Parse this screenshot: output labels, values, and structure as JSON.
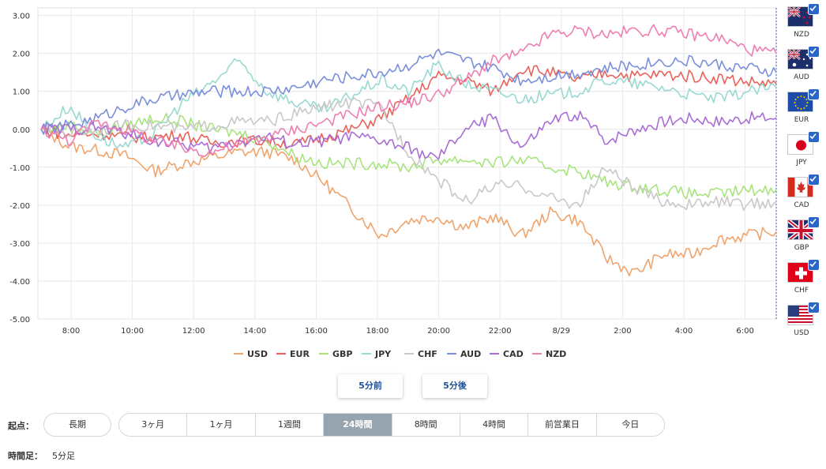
{
  "chart_data": {
    "type": "line",
    "ylim": [
      -5,
      3.2
    ],
    "y_ticks": [
      "3.00",
      "2.00",
      "1.00",
      "0.00",
      "-1.00",
      "-2.00",
      "-3.00",
      "-4.00",
      "-5.00"
    ],
    "x_ticks": [
      "8:00",
      "10:00",
      "12:00",
      "14:00",
      "16:00",
      "18:00",
      "20:00",
      "22:00",
      "8/29",
      "2:00",
      "4:00",
      "6:00"
    ],
    "grid": true,
    "legend_position": "bottom",
    "series": [
      {
        "name": "USD",
        "color": "#f0a46c",
        "values": [
          0,
          -0.45,
          -0.55,
          -0.7,
          -1.1,
          -0.9,
          -0.75,
          -0.6,
          -0.6,
          -0.8,
          -1.4,
          -2.1,
          -2.8,
          -2.4,
          -2.3,
          -2.6,
          -2.3,
          -2.8,
          -2.2,
          -2.4,
          -3.4,
          -3.8,
          -3.3,
          -3.3,
          -2.9,
          -2.8,
          -2.7
        ]
      },
      {
        "name": "EUR",
        "color": "#e8625b",
        "values": [
          0,
          -0.15,
          -0.1,
          -0.2,
          -0.2,
          -0.15,
          -0.35,
          -0.3,
          -0.3,
          -0.4,
          -0.2,
          0,
          0.3,
          0.8,
          1.4,
          1.3,
          1.0,
          1.6,
          1.5,
          1.3,
          1.5,
          1.4,
          1.45,
          1.4,
          1.35,
          1.25,
          1.2
        ]
      },
      {
        "name": "GBP",
        "color": "#a8e47e",
        "values": [
          0,
          0.1,
          -0.1,
          0.1,
          0.3,
          0.2,
          0,
          -0.1,
          -0.3,
          -0.7,
          -0.9,
          -0.9,
          -0.9,
          -1.0,
          -0.8,
          -0.8,
          -0.9,
          -0.8,
          -1.0,
          -1.1,
          -1.4,
          -1.5,
          -1.6,
          -1.7,
          -1.7,
          -1.6,
          -1.6
        ]
      },
      {
        "name": "JPY",
        "color": "#9ad9d2",
        "values": [
          0,
          0.6,
          -0.2,
          -0.5,
          -0.1,
          0.7,
          1.2,
          1.8,
          1.0,
          0.7,
          0.5,
          0.9,
          1.3,
          1.0,
          1.7,
          1.2,
          1.0,
          0.8,
          0.9,
          1.0,
          1.3,
          1.2,
          1.1,
          0.9,
          0.8,
          1.0,
          1.1
        ]
      },
      {
        "name": "CHF",
        "color": "#c9c9c9",
        "values": [
          0,
          -0.1,
          0,
          0.1,
          0.1,
          0,
          0.1,
          0.2,
          0.2,
          0.4,
          0.6,
          0.7,
          0.6,
          -0.6,
          -1.3,
          -1.9,
          -1.5,
          -1.5,
          -1.8,
          -2.0,
          -1.0,
          -1.6,
          -1.9,
          -2.0,
          -1.9,
          -2.0,
          -1.9
        ]
      },
      {
        "name": "AUD",
        "color": "#7b8fdb",
        "values": [
          0,
          0.1,
          0.3,
          0.6,
          0.8,
          0.9,
          1.0,
          1.0,
          1.0,
          1.1,
          1.3,
          1.4,
          1.5,
          1.7,
          2.0,
          1.8,
          1.6,
          1.3,
          1.4,
          1.5,
          1.6,
          1.7,
          1.8,
          1.8,
          1.7,
          1.6,
          1.5
        ]
      },
      {
        "name": "CAD",
        "color": "#a96ed6",
        "values": [
          0,
          0,
          0.05,
          -0.1,
          -0.3,
          -0.4,
          -0.5,
          -0.3,
          -0.2,
          -0.4,
          -0.3,
          -0.2,
          -0.3,
          -0.5,
          -0.8,
          0,
          0.3,
          -0.5,
          0.2,
          0.4,
          -0.3,
          0,
          0.2,
          0.3,
          0.2,
          0.3,
          0.3
        ]
      },
      {
        "name": "NZD",
        "color": "#ee7fb2",
        "values": [
          0,
          -0.3,
          0.2,
          0,
          -0.3,
          -0.5,
          -0.6,
          -0.4,
          -0.2,
          0,
          0.2,
          0.4,
          0.6,
          0.7,
          0.9,
          1.3,
          1.8,
          2.0,
          2.5,
          2.6,
          2.5,
          2.6,
          2.6,
          2.5,
          2.4,
          2.1,
          2.0
        ]
      }
    ]
  },
  "flags": [
    {
      "code": "NZD",
      "checked": true
    },
    {
      "code": "AUD",
      "checked": true
    },
    {
      "code": "EUR",
      "checked": true
    },
    {
      "code": "JPY",
      "checked": true
    },
    {
      "code": "CAD",
      "checked": true
    },
    {
      "code": "GBP",
      "checked": true
    },
    {
      "code": "CHF",
      "checked": true
    },
    {
      "code": "USD",
      "checked": true
    }
  ],
  "nav": {
    "prev_label": "5分前",
    "next_label": "5分後"
  },
  "range": {
    "label": "起点：",
    "long_label": "長期",
    "options": [
      "3ヶ月",
      "1ヶ月",
      "1週間",
      "24時間",
      "8時間",
      "4時間",
      "前営業日",
      "今日"
    ],
    "active": "24時間"
  },
  "timeframe": {
    "label": "時間足：",
    "value": "5分足"
  }
}
